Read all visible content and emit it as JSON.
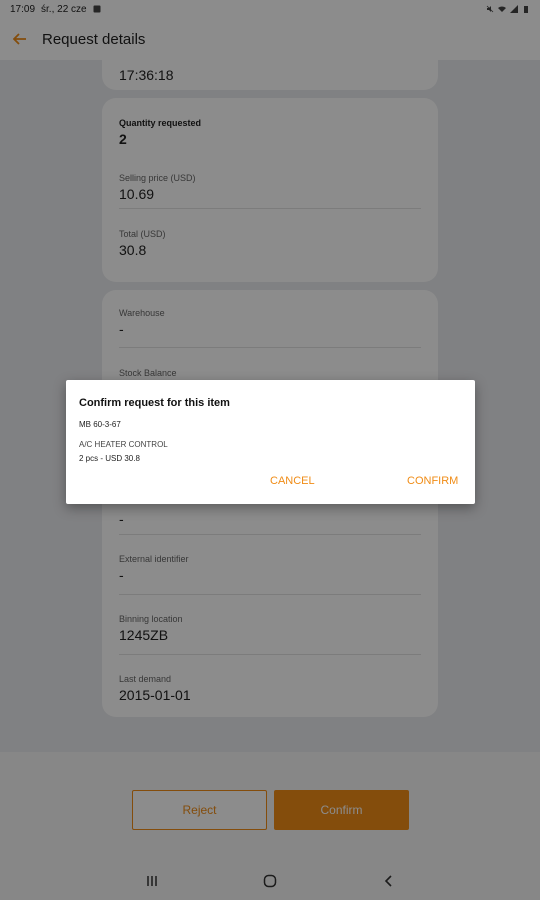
{
  "status_bar": {
    "time": "17:09",
    "date": "śr., 22 cze"
  },
  "app_bar": {
    "title": "Request details"
  },
  "card_top": {
    "value": "17:36:18"
  },
  "card_quantity": {
    "quantity_label": "Quantity requested",
    "quantity_value": "2",
    "price_label": "Selling price (USD)",
    "price_value": "10.69",
    "total_label": "Total (USD)",
    "total_value": "30.8"
  },
  "card_stock": {
    "warehouse_label": "Warehouse",
    "warehouse_value": "-",
    "stock_label": "Stock Balance",
    "hidden_value": "-",
    "external_label": "External identifier",
    "external_value": "-",
    "binning_label": "Binning location",
    "binning_value": "1245ZB",
    "demand_label": "Last demand",
    "demand_value": "2015-01-01"
  },
  "actions": {
    "reject": "Reject",
    "confirm": "Confirm"
  },
  "dialog": {
    "title": "Confirm request for this item",
    "code": "MB 60-3-67",
    "name": "A/C HEATER CONTROL",
    "summary": "2 pcs - USD 30.8",
    "cancel": "CANCEL",
    "confirm": "CONFIRM"
  },
  "colors": {
    "accent": "#f08c16"
  }
}
